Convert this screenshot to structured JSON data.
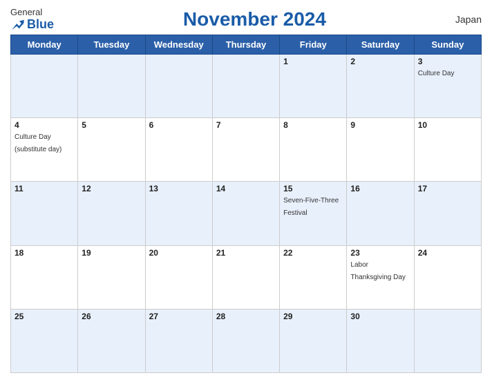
{
  "header": {
    "logo_general": "General",
    "logo_blue": "Blue",
    "title": "November 2024",
    "country": "Japan"
  },
  "weekdays": [
    "Monday",
    "Tuesday",
    "Wednesday",
    "Thursday",
    "Friday",
    "Saturday",
    "Sunday"
  ],
  "weeks": [
    [
      {
        "day": "",
        "events": []
      },
      {
        "day": "",
        "events": []
      },
      {
        "day": "",
        "events": []
      },
      {
        "day": "",
        "events": []
      },
      {
        "day": "1",
        "events": []
      },
      {
        "day": "2",
        "events": []
      },
      {
        "day": "3",
        "events": [
          "Culture Day"
        ]
      }
    ],
    [
      {
        "day": "4",
        "events": [
          "Culture Day (substitute day)"
        ]
      },
      {
        "day": "5",
        "events": []
      },
      {
        "day": "6",
        "events": []
      },
      {
        "day": "7",
        "events": []
      },
      {
        "day": "8",
        "events": []
      },
      {
        "day": "9",
        "events": []
      },
      {
        "day": "10",
        "events": []
      }
    ],
    [
      {
        "day": "11",
        "events": []
      },
      {
        "day": "12",
        "events": []
      },
      {
        "day": "13",
        "events": []
      },
      {
        "day": "14",
        "events": []
      },
      {
        "day": "15",
        "events": [
          "Seven-Five-Three Festival"
        ]
      },
      {
        "day": "16",
        "events": []
      },
      {
        "day": "17",
        "events": []
      }
    ],
    [
      {
        "day": "18",
        "events": []
      },
      {
        "day": "19",
        "events": []
      },
      {
        "day": "20",
        "events": []
      },
      {
        "day": "21",
        "events": []
      },
      {
        "day": "22",
        "events": []
      },
      {
        "day": "23",
        "events": [
          "Labor Thanksgiving Day"
        ]
      },
      {
        "day": "24",
        "events": []
      }
    ],
    [
      {
        "day": "25",
        "events": []
      },
      {
        "day": "26",
        "events": []
      },
      {
        "day": "27",
        "events": []
      },
      {
        "day": "28",
        "events": []
      },
      {
        "day": "29",
        "events": []
      },
      {
        "day": "30",
        "events": []
      },
      {
        "day": "",
        "events": []
      }
    ]
  ],
  "colors": {
    "header_bg": "#2b5fa8",
    "row_odd_bg": "#dce8f8",
    "row_even_bg": "#ffffff",
    "title_color": "#1a5ca8"
  }
}
